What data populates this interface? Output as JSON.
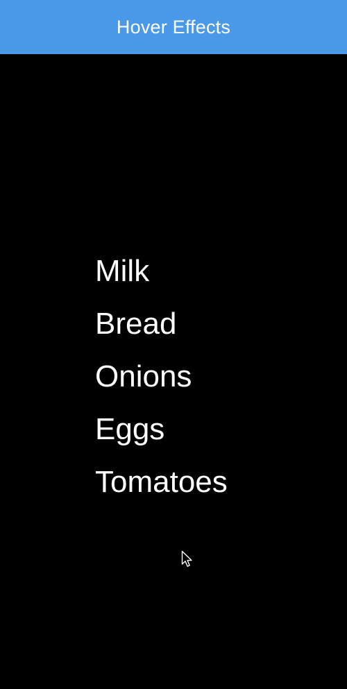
{
  "app_bar": {
    "title": "Hover Effects",
    "color": "#4A99E9"
  },
  "list": {
    "items": [
      {
        "label": "Milk"
      },
      {
        "label": "Bread"
      },
      {
        "label": "Onions"
      },
      {
        "label": "Eggs"
      },
      {
        "label": "Tomatoes"
      }
    ]
  },
  "cursor": {
    "icon": "mouse-pointer-icon"
  }
}
